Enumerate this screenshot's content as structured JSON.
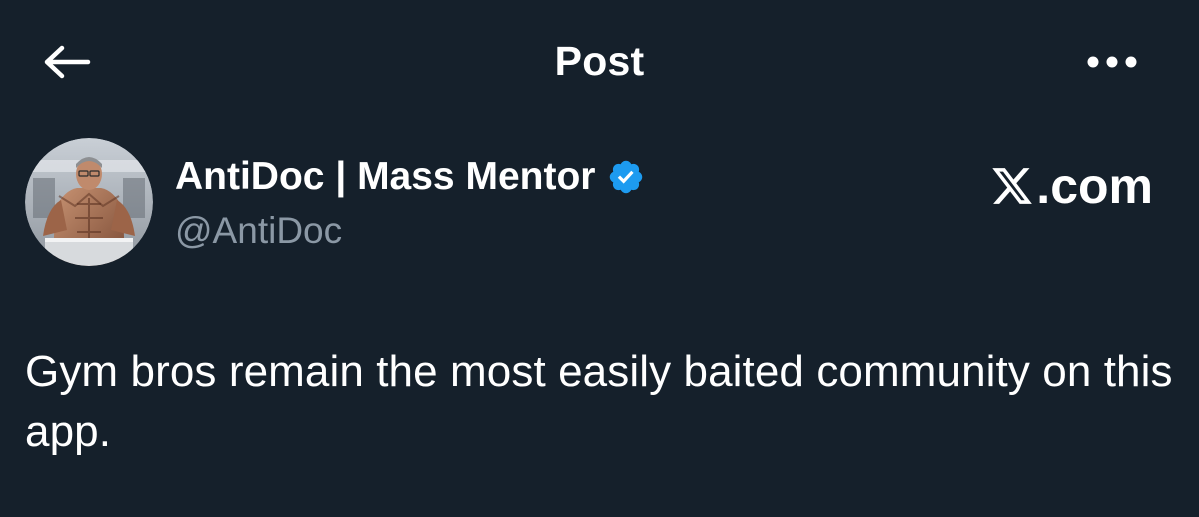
{
  "header": {
    "title": "Post",
    "back_icon": "arrow-left-icon",
    "more_icon": "more-horizontal-icon"
  },
  "author": {
    "display_name": "AntiDoc | Mass Mentor",
    "handle": "@AntiDoc",
    "verified_icon": "verified-badge-icon",
    "avatar": "muscular man in kitchen"
  },
  "watermark": {
    "text": ".com",
    "logo": "x-logo-icon"
  },
  "post": {
    "text": "Gym bros remain the most easily baited community on this app."
  },
  "colors": {
    "background": "#15202b",
    "text": "#ffffff",
    "secondary": "#8b98a5",
    "verified": "#1d9bf0"
  }
}
